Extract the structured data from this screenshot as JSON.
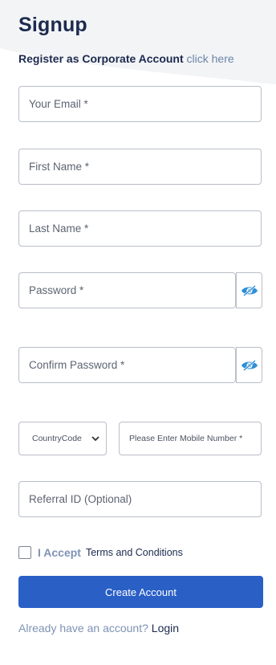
{
  "header": {
    "title": "Signup",
    "corporate_text": "Register as Corporate Account",
    "corporate_link": "click here"
  },
  "form": {
    "email_placeholder": "Your Email *",
    "first_name_placeholder": "First Name *",
    "last_name_placeholder": "Last Name *",
    "password_placeholder": "Password *",
    "confirm_password_placeholder": "Confirm Password *",
    "country_code_selected": "CountryCode",
    "mobile_placeholder": "Please Enter Mobile Number *",
    "referral_placeholder": "Referral ID (Optional)",
    "accept_label": "I Accept",
    "terms_link": "Terms and Conditions",
    "submit_label": "Create Account"
  },
  "footer": {
    "question": "Already have an account?",
    "login_link": "Login"
  },
  "colors": {
    "primary": "#2a5fc6",
    "heading": "#1c2a4e",
    "muted_link": "#7f93b4",
    "eye_icon": "#2d8fd8"
  },
  "icons": {
    "password_toggle": "eye-slash-icon",
    "select_arrow": "chevron-down-icon"
  }
}
